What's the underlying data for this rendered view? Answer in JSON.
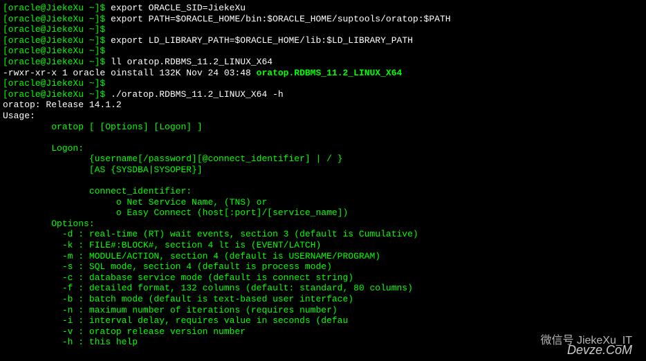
{
  "prompt": "[oracle@JiekeXu ~]$",
  "lines": {
    "cmd1": "export ORACLE_SID=JiekeXu",
    "cmd2": "export PATH=$ORACLE_HOME/bin:$ORACLE_HOME/suptools/oratop:$PATH",
    "cmd3": "export LD_LIBRARY_PATH=$ORACLE_HOME/lib:$LD_LIBRARY_PATH",
    "cmd4": "ll oratop.RDBMS_11.2_LINUX_X64",
    "ls_output_prefix": "-rwxr-xr-x 1 oracle oinstall 132K Nov 24 03:48 ",
    "ls_output_file": "oratop.RDBMS_11.2_LINUX_X64",
    "cmd5": "./oratop.RDBMS_11.2_LINUX_X64 -h",
    "release": "oratop: Release 14.1.2",
    "usage_label": "Usage:",
    "usage_syntax": "         oratop [ [Options] [Logon] ]",
    "logon_label": "         Logon:",
    "logon_line1": "                {username[/password][@connect_identifier] | / }",
    "logon_line2": "                [AS {SYSDBA|SYSOPER}]",
    "connect_label": "                connect_identifier:",
    "connect_line1": "                     o Net Service Name, (TNS) or",
    "connect_line2": "                     o Easy Connect (host[:port]/[service_name])",
    "options_label": "         Options:",
    "opt_d": "           -d : real-time (RT) wait events, section 3 (default is Cumulative)",
    "opt_k": "           -k : FILE#:BLOCK#, section 4 lt is (EVENT/LATCH)",
    "opt_m": "           -m : MODULE/ACTION, section 4 (default is USERNAME/PROGRAM)",
    "opt_s": "           -s : SQL mode, section 4 (default is process mode)",
    "opt_c": "           -c : database service mode (default is connect string)",
    "opt_f": "           -f : detailed format, 132 columns (default: standard, 80 columns)",
    "opt_b": "           -b : batch mode (default is text-based user interface)",
    "opt_n": "           -n : maximum number of iterations (requires number)",
    "opt_i": "           -i : interval delay, requires value in seconds (defau",
    "opt_v": "           -v : oratop release version number",
    "opt_h": "           -h : this help"
  },
  "watermark1": "微信号 JiekeXu_IT",
  "watermark2": "Devze.CoM"
}
